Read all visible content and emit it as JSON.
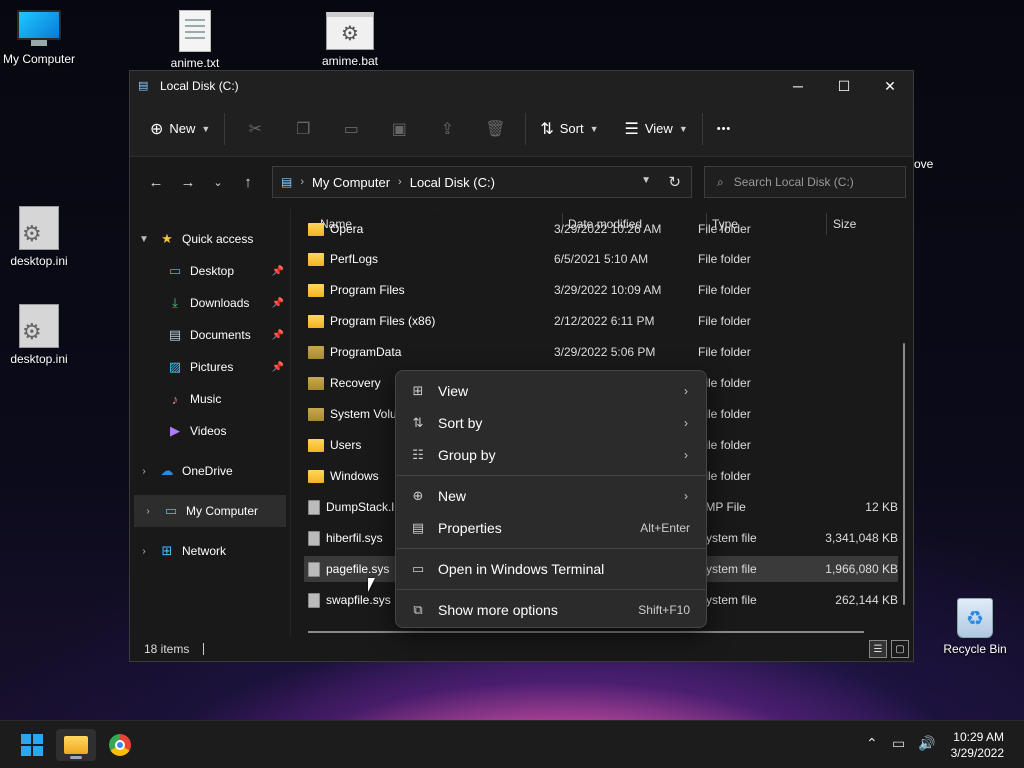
{
  "desktop": {
    "icons": [
      {
        "label": "My Computer"
      },
      {
        "label": "anime.txt"
      },
      {
        "label": "amime.bat"
      },
      {
        "label": "desktop.ini"
      },
      {
        "label": "desktop.ini"
      },
      {
        "label": "Recycle Bin"
      }
    ],
    "partial_text": "ove"
  },
  "window": {
    "title": "Local Disk (C:)",
    "controls": {
      "minimize": "─",
      "maximize": "☐",
      "close": "✕"
    }
  },
  "toolbar": {
    "new_label": "New",
    "sort_label": "Sort",
    "view_label": "View",
    "more_label": "•••"
  },
  "address": {
    "crumbs": [
      "My Computer",
      "Local Disk (C:)"
    ],
    "search_placeholder": "Search Local Disk (C:)"
  },
  "nav": {
    "quick_access": "Quick access",
    "quick_items": [
      "Desktop",
      "Downloads",
      "Documents",
      "Pictures",
      "Music",
      "Videos"
    ],
    "onedrive": "OneDrive",
    "my_computer": "My Computer",
    "network": "Network"
  },
  "columns": {
    "name": "Name",
    "date": "Date modified",
    "type": "Type",
    "size": "Size"
  },
  "files": [
    {
      "name": "Opera",
      "date": "3/29/2022 10:26 AM",
      "type": "File folder",
      "size": ""
    },
    {
      "name": "PerfLogs",
      "date": "6/5/2021 5:10 AM",
      "type": "File folder",
      "size": ""
    },
    {
      "name": "Program Files",
      "date": "3/29/2022 10:09 AM",
      "type": "File folder",
      "size": ""
    },
    {
      "name": "Program Files (x86)",
      "date": "2/12/2022 6:11 PM",
      "type": "File folder",
      "size": ""
    },
    {
      "name": "ProgramData",
      "date": "3/29/2022 5:06 PM",
      "type": "File folder",
      "size": ""
    },
    {
      "name": "Recovery",
      "date": "",
      "type": "File folder",
      "size": ""
    },
    {
      "name": "System Volu",
      "date": "",
      "type": "File folder",
      "size": ""
    },
    {
      "name": "Users",
      "date": "",
      "type": "File folder",
      "size": ""
    },
    {
      "name": "Windows",
      "date": "",
      "type": "File folder",
      "size": ""
    },
    {
      "name": "DumpStack.l",
      "date": "",
      "type": "TMP File",
      "size": "12 KB"
    },
    {
      "name": "hiberfil.sys",
      "date": "",
      "type": "System file",
      "size": "3,341,048 KB"
    },
    {
      "name": "pagefile.sys",
      "date": "",
      "type": "System file",
      "size": "1,966,080 KB"
    },
    {
      "name": "swapfile.sys",
      "date": "",
      "type": "System file",
      "size": "262,144 KB"
    }
  ],
  "status": {
    "items": "18 items"
  },
  "context_menu": {
    "view": "View",
    "sort_by": "Sort by",
    "group_by": "Group by",
    "new": "New",
    "properties": "Properties",
    "properties_shortcut": "Alt+Enter",
    "terminal": "Open in Windows Terminal",
    "more": "Show more options",
    "more_shortcut": "Shift+F10"
  },
  "taskbar": {
    "time": "10:29 AM",
    "date": "3/29/2022"
  }
}
